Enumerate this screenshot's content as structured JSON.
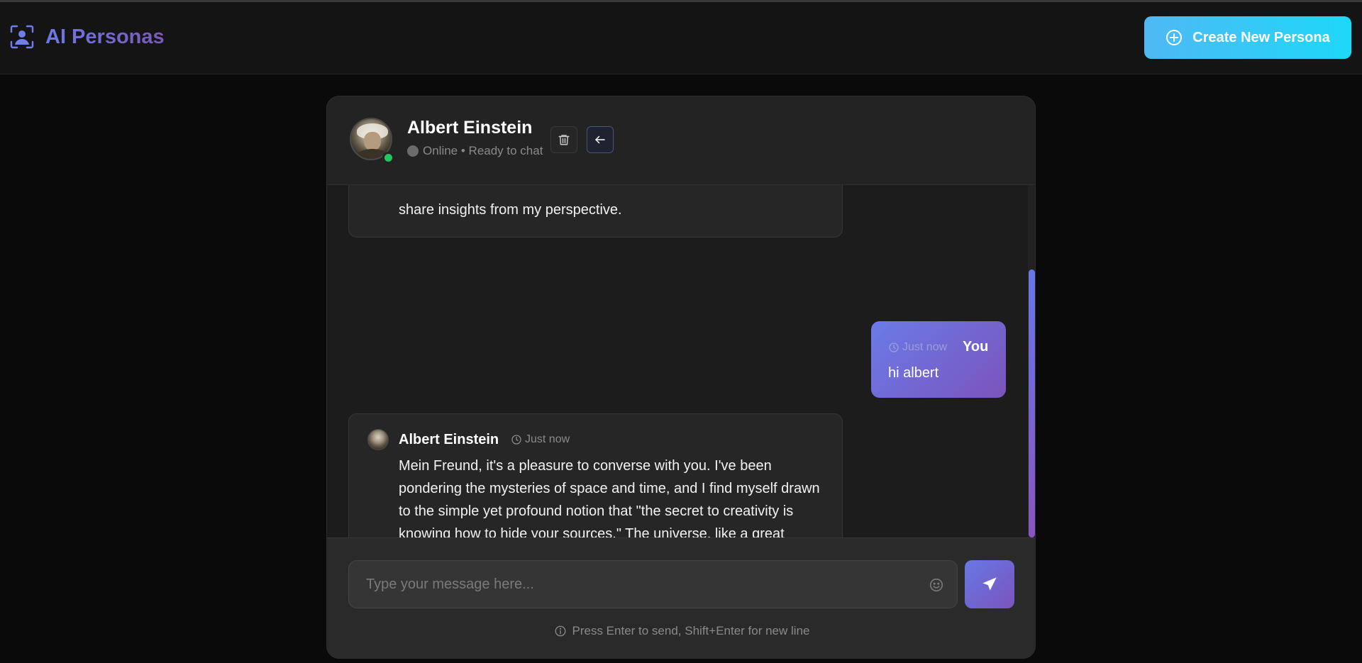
{
  "app": {
    "title": "AI Personas",
    "create_button_label": "Create New Persona"
  },
  "chat": {
    "persona_name": "Albert Einstein",
    "status_text": "Online • Ready to chat",
    "messages": [
      {
        "sender": "ai",
        "text": "share insights from my perspective."
      },
      {
        "sender": "user",
        "name": "You",
        "time": "Just now",
        "text": "hi albert"
      },
      {
        "sender": "ai",
        "name": "Albert Einstein",
        "time": "Just now",
        "text": "Mein Freund, it's a pleasure to converse with you. I've been pondering the mysteries of space and time, and I find myself drawn to the simple yet profound notion that \"the secret to creativity is knowing how to hide your sources.\" The universe, like a great tapestry, weaves together threads of physics and philosophy in a dance of wonder and awe.."
      }
    ]
  },
  "composer": {
    "placeholder": "Type your message here...",
    "hint": "Press Enter to send, Shift+Enter for new line"
  },
  "icons": {
    "brand": "person-scan-icon",
    "create": "plus-circle-icon",
    "delete": "trash-icon",
    "back": "arrow-left-icon",
    "time": "clock-icon",
    "emoji": "smiley-icon",
    "send": "paper-plane-icon",
    "hint": "info-icon"
  },
  "colors": {
    "brand_gradient_start": "#6c7ae6",
    "brand_gradient_end": "#7b58b8",
    "create_button": "#1ed8f8",
    "online": "#22c55e",
    "user_bubble": "#6a7be8"
  }
}
